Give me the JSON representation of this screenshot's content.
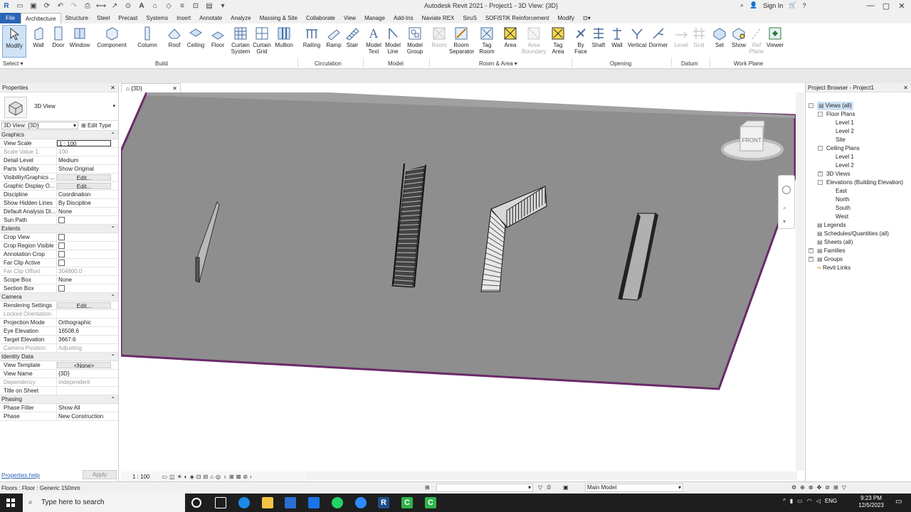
{
  "window": {
    "title": "Autodesk Revit 2021 - Project1 - 3D View: {3D}",
    "sign_in": "Sign In"
  },
  "tabs": [
    "File",
    "Architecture",
    "Structure",
    "Steel",
    "Precast",
    "Systems",
    "Insert",
    "Annotate",
    "Analyze",
    "Massing & Site",
    "Collaborate",
    "View",
    "Manage",
    "Add-Ins",
    "Naviate REX",
    "SiruS",
    "SOFiSTiK Reinforcement",
    "Modify"
  ],
  "ribbon": {
    "modify": "Modify",
    "select": "Select",
    "build": {
      "label": "Build",
      "wall": "Wall",
      "door": "Door",
      "window": "Window",
      "component": "Component",
      "column": "Column",
      "roof": "Roof",
      "ceiling": "Ceiling",
      "floor": "Floor",
      "curtain_system_1": "Curtain",
      "curtain_system_2": "System",
      "curtain_grid_1": "Curtain",
      "curtain_grid_2": "Grid",
      "mullion": "Mullion"
    },
    "circulation": {
      "label": "Circulation",
      "railing": "Railing",
      "ramp": "Ramp",
      "stair": "Stair"
    },
    "model": {
      "label": "Model",
      "model_text_1": "Model",
      "model_text_2": "Text",
      "model_line_1": "Model",
      "model_line_2": "Line",
      "model_group_1": "Model",
      "model_group_2": "Group"
    },
    "room_area": {
      "label": "Room & Area",
      "room": "Room",
      "room_sep_1": "Room",
      "room_sep_2": "Separator",
      "tag_room_1": "Tag",
      "tag_room_2": "Room",
      "area": "Area",
      "area_boundary_1": "Area",
      "area_boundary_2": "Boundary",
      "tag_area_1": "Tag",
      "tag_area_2": "Area"
    },
    "opening": {
      "label": "Opening",
      "by_face_1": "By",
      "by_face_2": "Face",
      "shaft": "Shaft",
      "wall": "Wall",
      "vertical": "Vertical",
      "dormer": "Dormer"
    },
    "datum": {
      "label": "Datum",
      "level": "Level",
      "grid": "Grid"
    },
    "work_plane": {
      "label": "Work Plane",
      "set": "Set",
      "show": "Show",
      "ref_plane_1": "Ref",
      "ref_plane_2": "Plane",
      "viewer": "Viewer"
    }
  },
  "doc_tab": {
    "label": "{3D}"
  },
  "properties": {
    "title": "Properties",
    "type_name": "3D View",
    "selector": "3D View: {3D}",
    "edit_type": "Edit Type",
    "groups": [
      {
        "name": "Graphics",
        "rows": [
          {
            "k": "View Scale",
            "v": "1 : 100",
            "style": "box"
          },
          {
            "k": "Scale Value    1:",
            "v": "100",
            "style": "dim"
          },
          {
            "k": "Detail Level",
            "v": "Medium"
          },
          {
            "k": "Parts Visibility",
            "v": "Show Original"
          },
          {
            "k": "Visibility/Graphics ...",
            "v": "Edit...",
            "style": "btn"
          },
          {
            "k": "Graphic Display O...",
            "v": "Edit...",
            "style": "btn"
          },
          {
            "k": "Discipline",
            "v": "Coordination"
          },
          {
            "k": "Show Hidden Lines",
            "v": "By Discipline"
          },
          {
            "k": "Default Analysis Di...",
            "v": "None"
          },
          {
            "k": "Sun Path",
            "v": "",
            "style": "chk"
          }
        ]
      },
      {
        "name": "Extents",
        "rows": [
          {
            "k": "Crop View",
            "v": "",
            "style": "chk"
          },
          {
            "k": "Crop Region Visible",
            "v": "",
            "style": "chk"
          },
          {
            "k": "Annotation Crop",
            "v": "",
            "style": "chk"
          },
          {
            "k": "Far Clip Active",
            "v": "",
            "style": "chk"
          },
          {
            "k": "Far Clip Offset",
            "v": "304800.0",
            "style": "dim"
          },
          {
            "k": "Scope Box",
            "v": "None"
          },
          {
            "k": "Section Box",
            "v": "",
            "style": "chk"
          }
        ]
      },
      {
        "name": "Camera",
        "rows": [
          {
            "k": "Rendering Settings",
            "v": "Edit...",
            "style": "btn"
          },
          {
            "k": "Locked Orientation",
            "v": "",
            "style": "dim"
          },
          {
            "k": "Projection Mode",
            "v": "Orthographic"
          },
          {
            "k": "Eye Elevation",
            "v": "16508.6"
          },
          {
            "k": "Target Elevation",
            "v": "3667.6"
          },
          {
            "k": "Camera Position",
            "v": "Adjusting",
            "style": "dim"
          }
        ]
      },
      {
        "name": "Identity Data",
        "rows": [
          {
            "k": "View Template",
            "v": "<None>",
            "style": "btn"
          },
          {
            "k": "View Name",
            "v": "{3D}"
          },
          {
            "k": "Dependency",
            "v": "Independent",
            "style": "dim"
          },
          {
            "k": "Title on Sheet",
            "v": ""
          }
        ]
      },
      {
        "name": "Phasing",
        "rows": [
          {
            "k": "Phase Filter",
            "v": "Show All"
          },
          {
            "k": "Phase",
            "v": "New Construction"
          }
        ]
      }
    ],
    "help": "Properties help",
    "apply": "Apply"
  },
  "viewcube": {
    "face": "FRONT"
  },
  "view_scale": "1 : 100",
  "browser": {
    "title": "Project Browser - Project1",
    "items": [
      {
        "label": "Views (all)",
        "depth": 0,
        "pm": "-",
        "sel": true
      },
      {
        "label": "Floor Plans",
        "depth": 1,
        "pm": "-"
      },
      {
        "label": "Level 1",
        "depth": 2
      },
      {
        "label": "Level 2",
        "depth": 2
      },
      {
        "label": "Site",
        "depth": 2
      },
      {
        "label": "Ceiling Plans",
        "depth": 1,
        "pm": "-"
      },
      {
        "label": "Level 1",
        "depth": 2
      },
      {
        "label": "Level 2",
        "depth": 2
      },
      {
        "label": "3D Views",
        "depth": 1,
        "pm": "+"
      },
      {
        "label": "Elevations (Building Elevation)",
        "depth": 1,
        "pm": "-"
      },
      {
        "label": "East",
        "depth": 2
      },
      {
        "label": "North",
        "depth": 2
      },
      {
        "label": "South",
        "depth": 2
      },
      {
        "label": "West",
        "depth": 2
      },
      {
        "label": "Legends",
        "depth": 0
      },
      {
        "label": "Schedules/Quantities (all)",
        "depth": 0
      },
      {
        "label": "Sheets (all)",
        "depth": 0
      },
      {
        "label": "Families",
        "depth": 0,
        "pm": "+"
      },
      {
        "label": "Groups",
        "depth": 0,
        "pm": "+"
      },
      {
        "label": "Revit Links",
        "depth": 0
      }
    ]
  },
  "status": {
    "text": "Floors : Floor : Generic 150mm",
    "selection_count": ":0",
    "model": "Main Model"
  },
  "taskbar": {
    "search": "Type here to search",
    "lang": "ENG",
    "time": "9:23 PM",
    "date": "12/5/2023"
  }
}
